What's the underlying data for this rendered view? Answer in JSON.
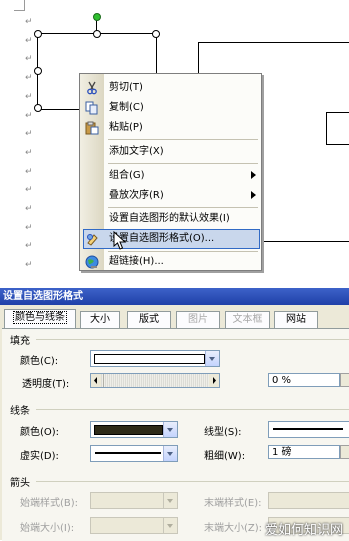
{
  "context_menu": {
    "items": [
      {
        "label": "剪切(T)",
        "icon": "scissors-icon"
      },
      {
        "label": "复制(C)",
        "icon": "copy-icon"
      },
      {
        "label": "粘贴(P)",
        "icon": "paste-icon"
      },
      {
        "label": "添加文字(X)"
      },
      {
        "label": "组合(G)",
        "submenu": true
      },
      {
        "label": "叠放次序(R)",
        "submenu": true
      },
      {
        "label": "设置自选图形的默认效果(I)"
      },
      {
        "label": "设置自选图形格式(O)...",
        "icon": "format-shape-icon",
        "highlighted": true
      },
      {
        "label": "超链接(H)...",
        "icon": "hyperlink-globe-icon"
      }
    ]
  },
  "dialog": {
    "title": "设置自选图形格式",
    "tabs": [
      {
        "label": "颜色与线条",
        "selected": true
      },
      {
        "label": "大小"
      },
      {
        "label": "版式"
      },
      {
        "label": "图片",
        "disabled": true
      },
      {
        "label": "文本框",
        "disabled": true
      },
      {
        "label": "网站"
      }
    ],
    "fill": {
      "section": "填充",
      "color_label": "颜色(C):",
      "color_value": "#ffffff",
      "transparency_label": "透明度(T):",
      "transparency_value": "0 %"
    },
    "line": {
      "section": "线条",
      "color_label": "颜色(O):",
      "color_value": "#2d2a18",
      "dash_label": "虚实(D):",
      "style_label": "线型(S):",
      "weight_label": "粗细(W):",
      "weight_value": "1 磅"
    },
    "arrows": {
      "section": "箭头",
      "begin_style_label": "始端样式(B):",
      "end_style_label": "末端样式(E):",
      "begin_size_label": "始端大小(I):",
      "end_size_label": "末端大小(Z):"
    }
  },
  "watermark": "爱如何知识网",
  "colors": {
    "highlight": "#c9d7ec",
    "title_bar": "#2a4fbd",
    "dialog_bg": "#ece9d8"
  }
}
